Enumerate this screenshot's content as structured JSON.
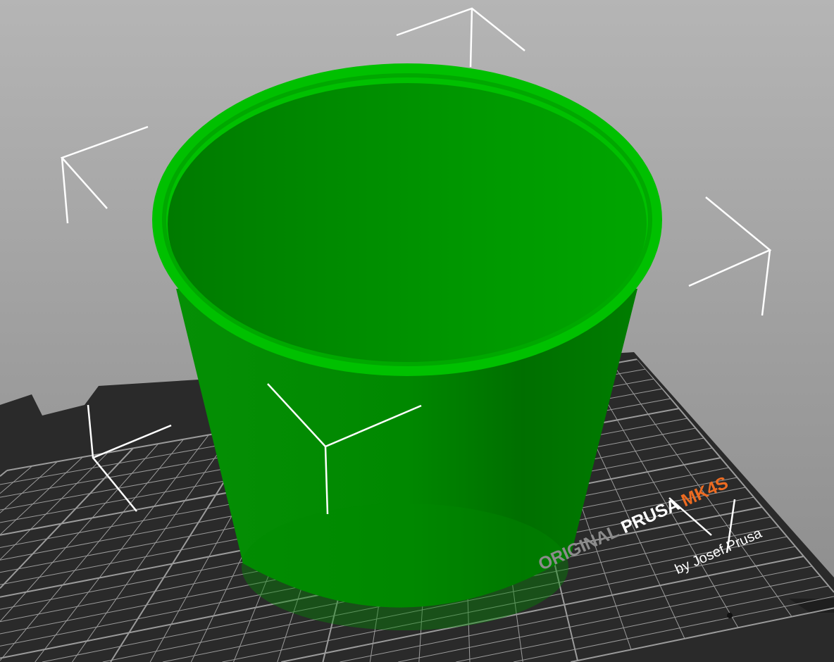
{
  "viewport": {
    "title": "3D view"
  },
  "bed": {
    "logo_original": "ORIGINAL",
    "logo_brand": "PRUSA",
    "logo_model": "MK4S",
    "logo_byline": "by Josef Prusa",
    "colors": {
      "bed": "#2e2e2e",
      "grid": "#bdbdbd",
      "accent": "#ed6b21"
    }
  },
  "object": {
    "color": "#00a000",
    "type": "cup"
  }
}
